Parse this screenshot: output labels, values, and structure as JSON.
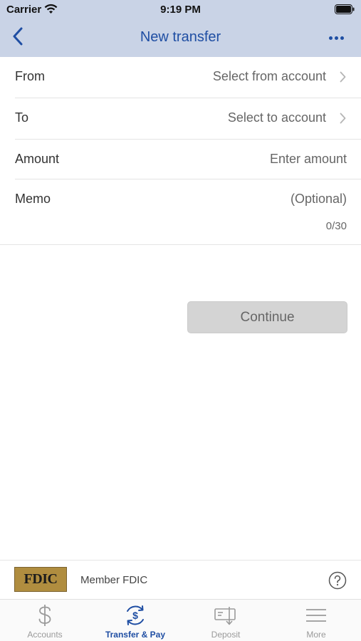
{
  "status_bar": {
    "carrier": "Carrier",
    "time": "9:19 PM"
  },
  "nav": {
    "title": "New transfer",
    "back_icon": "chevron-left-icon",
    "more_icon": "ellipsis-icon"
  },
  "form": {
    "from": {
      "label": "From",
      "value": "Select from account"
    },
    "to": {
      "label": "To",
      "value": "Select to account"
    },
    "amount": {
      "label": "Amount",
      "placeholder": "Enter amount"
    },
    "memo": {
      "label": "Memo",
      "placeholder": "(Optional)",
      "count": "0/30"
    }
  },
  "continue_label": "Continue",
  "footer": {
    "logo_text": "FDIC",
    "member_text": "Member FDIC"
  },
  "tabs": [
    {
      "label": "Accounts",
      "icon": "dollar-icon",
      "active": false
    },
    {
      "label": "Transfer & Pay",
      "icon": "transfer-icon",
      "active": true
    },
    {
      "label": "Deposit",
      "icon": "check-deposit-icon",
      "active": false
    },
    {
      "label": "More",
      "icon": "menu-icon",
      "active": false
    }
  ],
  "colors": {
    "header_bg": "#c9d3e6",
    "accent": "#1f4ea3",
    "button_disabled": "#d4d4d4"
  }
}
